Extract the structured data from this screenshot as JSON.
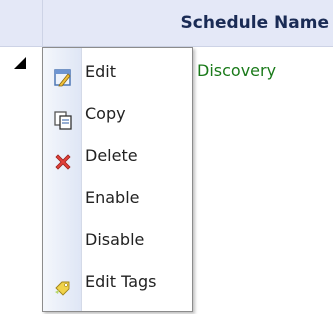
{
  "grid": {
    "column_header": "Schedule Name",
    "row": {
      "name": "Discovery"
    }
  },
  "context_menu": {
    "items": [
      {
        "label": "Edit",
        "icon": "edit-icon"
      },
      {
        "label": "Copy",
        "icon": "copy-icon"
      },
      {
        "label": "Delete",
        "icon": "delete-icon"
      },
      {
        "label": "Enable",
        "icon": ""
      },
      {
        "label": "Disable",
        "icon": ""
      },
      {
        "label": "Edit Tags",
        "icon": "tag-icon"
      }
    ]
  }
}
